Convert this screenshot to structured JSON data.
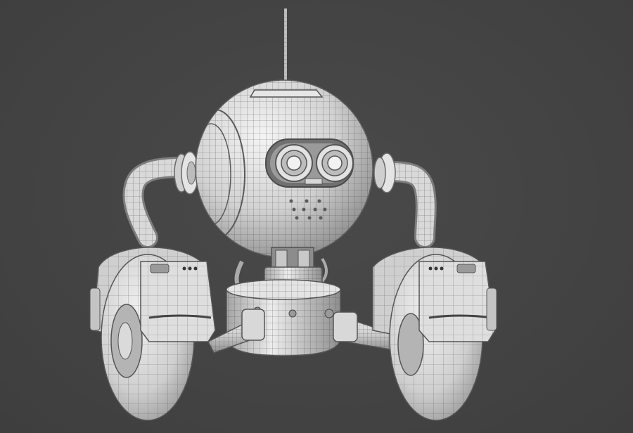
{
  "scene": {
    "subject": "robot-wireframe-render",
    "colors": {
      "background": "#444444",
      "body": "#dcdcdc",
      "body_light": "#f2f2f2",
      "body_shadow": "#8f8f8f",
      "wire": "#3a3a3a",
      "dark": "#5a5a5a"
    }
  }
}
